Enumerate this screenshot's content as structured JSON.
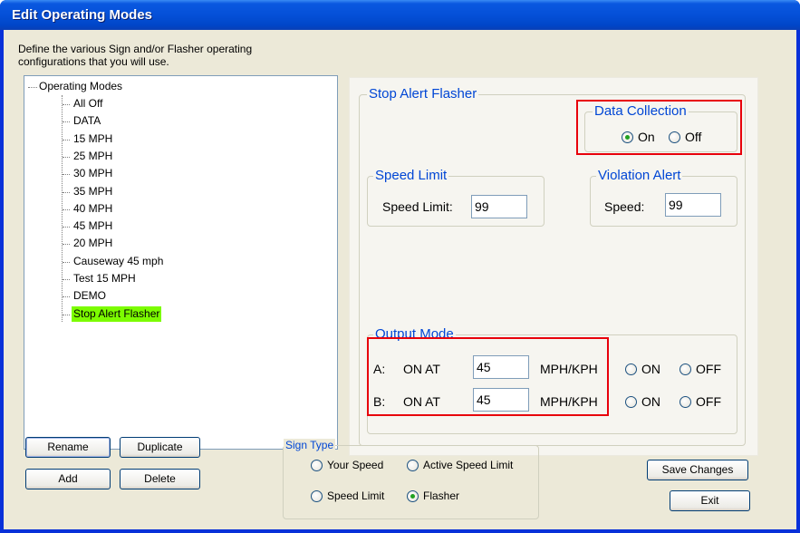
{
  "window": {
    "title": "Edit Operating Modes"
  },
  "description": {
    "line1": "Define the various Sign and/or Flasher operating",
    "line2": "configurations that you will use."
  },
  "tree": {
    "root": "Operating Modes",
    "items": [
      "All Off",
      "DATA",
      "15 MPH",
      "25 MPH",
      "30 MPH",
      "35 MPH",
      "40 MPH",
      "45 MPH",
      "20 MPH",
      "Causeway 45 mph",
      "Test 15 MPH",
      "DEMO",
      "Stop Alert Flasher"
    ],
    "selected_index": 12
  },
  "mode_panel": {
    "title": "Stop Alert Flasher",
    "data_collection": {
      "title": "Data Collection",
      "on_label": "On",
      "off_label": "Off",
      "selected": "On"
    },
    "speed_limit": {
      "title": "Speed Limit",
      "label": "Speed Limit:",
      "value": "99"
    },
    "violation_alert": {
      "title": "Violation Alert",
      "label": "Speed:",
      "value": "99"
    },
    "output_mode": {
      "title": "Output Mode",
      "rows": [
        {
          "channel": "A:",
          "on_at_label": "ON AT",
          "value": "45",
          "unit": "MPH/KPH",
          "on_label": "ON",
          "off_label": "OFF"
        },
        {
          "channel": "B:",
          "on_at_label": "ON AT",
          "value": "45",
          "unit": "MPH/KPH",
          "on_label": "ON",
          "off_label": "OFF"
        }
      ]
    }
  },
  "sign_type": {
    "title": "Sign Type",
    "options": [
      "Your Speed",
      "Active Speed Limit",
      "Speed Limit",
      "Flasher"
    ],
    "selected": "Flasher"
  },
  "buttons": {
    "rename": "Rename",
    "duplicate": "Duplicate",
    "add": "Add",
    "delete": "Delete",
    "save_changes": "Save Changes",
    "exit": "Exit"
  },
  "colors": {
    "titlebar": "#0550d8",
    "selected_highlight": "#7cfc00",
    "group_title": "#0046d5",
    "annotation_box": "#e8000b"
  }
}
